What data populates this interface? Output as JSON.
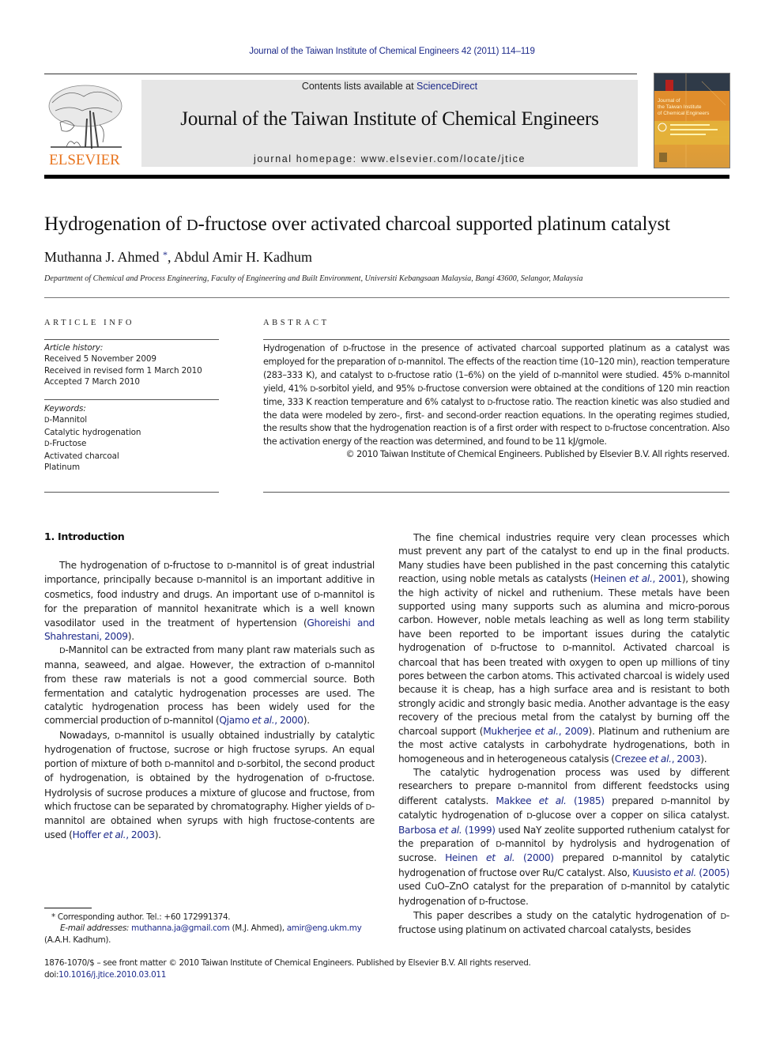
{
  "running_head": "Journal of the Taiwan Institute of Chemical Engineers 42 (2011) 114–119",
  "masthead": {
    "publisher_logo": "ELSEVIER",
    "contents_prefix": "Contents lists available at ",
    "contents_link": "ScienceDirect",
    "journal_name": "Journal of the Taiwan Institute of Chemical Engineers",
    "homepage": "journal homepage: www.elsevier.com/locate/jtice",
    "cover_title": "Journal of the Taiwan Institute of Chemical Engineers"
  },
  "article": {
    "title": [
      {
        "t": "Hydrogenation of "
      },
      {
        "sc": "D"
      },
      {
        "t": "-fructose over activated charcoal supported platinum catalyst"
      }
    ],
    "authors": [
      {
        "name": "Muthanna J. Ahmed",
        "mark": "*"
      },
      {
        "name": "Abdul Amir H. Kadhum"
      }
    ],
    "affiliation": "Department of Chemical and Process Engineering, Faculty of Engineering and Built Environment, Universiti Kebangsaan Malaysia, Bangi 43600, Selangor, Malaysia"
  },
  "article_info": {
    "heading": "ARTICLE INFO",
    "history_label": "Article history:",
    "history": [
      "Received 5 November 2009",
      "Received in revised form 1 March 2010",
      "Accepted 7 March 2010"
    ],
    "keywords_label": "Keywords:",
    "keywords": [
      [
        {
          "sc": "D"
        },
        {
          "t": "-Mannitol"
        }
      ],
      [
        {
          "t": "Catalytic hydrogenation"
        }
      ],
      [
        {
          "sc": "D"
        },
        {
          "t": "-Fructose"
        }
      ],
      [
        {
          "t": "Activated charcoal"
        }
      ],
      [
        {
          "t": "Platinum"
        }
      ]
    ]
  },
  "abstract": {
    "heading": "ABSTRACT",
    "body": [
      {
        "t": "Hydrogenation of "
      },
      {
        "sc": "D"
      },
      {
        "t": "-fructose in the presence of activated charcoal supported platinum as a catalyst was employed for the preparation of "
      },
      {
        "sc": "D"
      },
      {
        "t": "-mannitol. The effects of the reaction time (10–120 min), reaction temperature (283–333 K), and catalyst to "
      },
      {
        "sc": "D"
      },
      {
        "t": "-fructose ratio (1–6%) on the yield of "
      },
      {
        "sc": "D"
      },
      {
        "t": "-mannitol were studied. 45% "
      },
      {
        "sc": "D"
      },
      {
        "t": "-mannitol yield, 41% "
      },
      {
        "sc": "D"
      },
      {
        "t": "-sorbitol yield, and 95% "
      },
      {
        "sc": "D"
      },
      {
        "t": "-fructose conversion were obtained at the conditions of 120 min reaction time, 333 K reaction temperature and 6% catalyst to "
      },
      {
        "sc": "D"
      },
      {
        "t": "-fructose ratio. The reaction kinetic was also studied and the data were modeled by zero-, first- and second-order reaction equations. In the operating regimes studied, the results show that the hydrogenation reaction is of a first order with respect to "
      },
      {
        "sc": "D"
      },
      {
        "t": "-fructose concentration. Also the activation energy of the reaction was determined, and found to be 11 kJ/gmole."
      }
    ],
    "copyright": "© 2010 Taiwan Institute of Chemical Engineers. Published by Elsevier B.V. All rights reserved."
  },
  "introduction": {
    "heading": "1.  Introduction",
    "left_paragraphs": [
      [
        {
          "t": "The hydrogenation of "
        },
        {
          "sc": "D"
        },
        {
          "t": "-fructose to "
        },
        {
          "sc": "D"
        },
        {
          "t": "-mannitol is of great industrial importance, principally because "
        },
        {
          "sc": "D"
        },
        {
          "t": "-mannitol is an important additive in cosmetics, food industry and drugs. An important use of "
        },
        {
          "sc": "D"
        },
        {
          "t": "-mannitol is for the preparation of mannitol hexanitrate which is a well known vasodilator used in the treatment of hypertension ("
        },
        {
          "link": "Ghoreishi and Shahrestani, 2009"
        },
        {
          "t": ")."
        }
      ],
      [
        {
          "sc": "D"
        },
        {
          "t": "-Mannitol can be extracted from many plant raw materials such as manna, seaweed, and algae. However, the extraction of "
        },
        {
          "sc": "D"
        },
        {
          "t": "-mannitol from these raw materials is not a good commercial source. Both fermentation and catalytic hydrogenation processes are used. The catalytic hydrogenation process has been widely used for the commercial production of "
        },
        {
          "sc": "D"
        },
        {
          "t": "-mannitol ("
        },
        {
          "link": "Qjamo ",
          "it": "et al.",
          "rest": ", 2000"
        },
        {
          "t": ")."
        }
      ],
      [
        {
          "t": "Nowadays, "
        },
        {
          "sc": "D"
        },
        {
          "t": "-mannitol is usually obtained industrially by catalytic hydrogenation of fructose, sucrose or high fructose syrups. An equal portion of mixture of both "
        },
        {
          "sc": "D"
        },
        {
          "t": "-mannitol and "
        },
        {
          "sc": "D"
        },
        {
          "t": "-sorbitol, the second product of hydrogenation, is obtained by the hydrogenation of "
        },
        {
          "sc": "D"
        },
        {
          "t": "-fructose. Hydrolysis of sucrose produces a mixture of glucose and fructose, from which fructose can be separated by chromatography. Higher yields of "
        },
        {
          "sc": "D"
        },
        {
          "t": "-mannitol are obtained when syrups with high fructose-contents are used ("
        },
        {
          "link": "Hoffer ",
          "it": "et al.",
          "rest": ", 2003"
        },
        {
          "t": ")."
        }
      ]
    ],
    "right_paragraphs": [
      [
        {
          "t": "The fine chemical industries require very clean processes which must prevent any part of the catalyst to end up in the final products. Many studies have been published in the past concerning this catalytic reaction, using noble metals as catalysts ("
        },
        {
          "link": "Heinen ",
          "it": "et al.",
          "rest": ", 2001"
        },
        {
          "t": "), showing the high activity of nickel and ruthenium. These metals have been supported using many supports such as alumina and micro-porous carbon. However, noble metals leaching as well as long term stability have been reported to be important issues during the catalytic hydrogenation of "
        },
        {
          "sc": "D"
        },
        {
          "t": "-fructose to "
        },
        {
          "sc": "D"
        },
        {
          "t": "-mannitol. Activated charcoal is charcoal that has been treated with oxygen to open up millions of tiny pores between the carbon atoms. This activated charcoal is widely used because it is cheap, has a high surface area and is resistant to both strongly acidic and strongly basic media. Another advantage is the easy recovery of the precious metal from the catalyst by burning off the charcoal support ("
        },
        {
          "link": "Mukherjee ",
          "it": "et al.",
          "rest": ", 2009"
        },
        {
          "t": "). Platinum and ruthenium are the most active catalysts in carbohydrate hydrogenations, both in homogeneous and in heterogeneous catalysis ("
        },
        {
          "link": "Crezee ",
          "it": "et al.",
          "rest": ", 2003"
        },
        {
          "t": ")."
        }
      ],
      [
        {
          "t": "The catalytic hydrogenation process was used by different researchers to prepare "
        },
        {
          "sc": "D"
        },
        {
          "t": "-mannitol from different feedstocks using different catalysts. "
        },
        {
          "link": "Makkee ",
          "it": "et al.",
          "rest": " (1985)"
        },
        {
          "t": " prepared "
        },
        {
          "sc": "D"
        },
        {
          "t": "-mannitol by catalytic hydrogenation of "
        },
        {
          "sc": "D"
        },
        {
          "t": "-glucose over a copper on silica catalyst. "
        },
        {
          "link": "Barbosa ",
          "it": "et al.",
          "rest": " (1999)"
        },
        {
          "t": " used NaY zeolite supported ruthenium catalyst for the preparation of "
        },
        {
          "sc": "D"
        },
        {
          "t": "-mannitol by hydrolysis and hydrogenation of sucrose. "
        },
        {
          "link": "Heinen ",
          "it": "et al.",
          "rest": " (2000)"
        },
        {
          "t": " prepared "
        },
        {
          "sc": "D"
        },
        {
          "t": "-mannitol by catalytic hydrogenation of fructose over Ru/C catalyst. Also, "
        },
        {
          "link": "Kuusisto ",
          "it": "et al.",
          "rest": " (2005)"
        },
        {
          "t": " used CuO–ZnO catalyst for the preparation of "
        },
        {
          "sc": "D"
        },
        {
          "t": "-mannitol by catalytic hydrogenation of "
        },
        {
          "sc": "D"
        },
        {
          "t": "-fructose."
        }
      ],
      [
        {
          "t": "This paper describes a study on the catalytic hydrogenation of "
        },
        {
          "sc": "D"
        },
        {
          "t": "-fructose using platinum on activated charcoal catalysts, besides"
        }
      ]
    ]
  },
  "footnote": {
    "marker": "*",
    "corresponding": "Corresponding author. Tel.: +60 172991374.",
    "email_label": "E-mail addresses:",
    "email1": "muthanna.ja@gmail.com",
    "email1_owner": "(M.J. Ahmed),",
    "email2": "amir@eng.ukm.my",
    "email2_owner": "(A.A.H. Kadhum)."
  },
  "front_matter": {
    "issn_line": "1876-1070/$ – see front matter © 2010 Taiwan Institute of Chemical Engineers. Published by Elsevier B.V. All rights reserved.",
    "doi_prefix": "doi:",
    "doi": "10.1016/j.jtice.2010.03.011"
  },
  "colors": {
    "link": "#1d2a8a",
    "elsevier_orange": "#e8741e",
    "masthead_bg": "#e6e6e6"
  }
}
